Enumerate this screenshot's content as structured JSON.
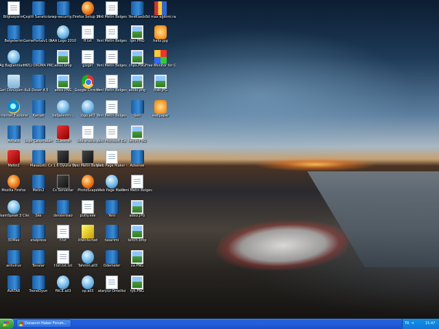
{
  "desktop": {
    "icons": [
      {
        "label": "Bilgisayarım",
        "type": "ic-doc",
        "icon": "computer-icon"
      },
      {
        "label": "Belgelerim",
        "type": "ic-folder",
        "icon": "my-documents-icon"
      },
      {
        "label": "Ağ Bağlantılarım",
        "type": "ic-orb",
        "icon": "network-icon"
      },
      {
        "label": "Geri Dönüşüm Kutusu",
        "type": "ic-trash",
        "icon": "recycle-bin-icon"
      },
      {
        "label": "Internet Explorer",
        "type": "ic-ie",
        "icon": "internet-explorer-icon"
      },
      {
        "label": "AvRack",
        "type": "ic-folder",
        "icon": "folder-icon"
      },
      {
        "label": "Metin2",
        "type": "ic-red",
        "icon": "game-icon"
      },
      {
        "label": "Mozilla Firefox",
        "type": "ic-app",
        "icon": "firefox-icon"
      },
      {
        "label": "TeamSpeak 3 Client",
        "type": "ic-orb",
        "icon": "teamspeak-icon"
      },
      {
        "label": "3DMax",
        "type": "ic-folder",
        "icon": "folder-icon"
      },
      {
        "label": "antivirus",
        "type": "ic-folder",
        "icon": "folder-icon"
      },
      {
        "label": "AVATAR",
        "type": "ic-folder",
        "icon": "folder-icon"
      },
      {
        "label": "Çeşitli Sanatcılar...",
        "type": "ic-folder",
        "icon": "folder-icon"
      },
      {
        "label": "GamePortalv1 Oyun Portalı...",
        "type": "ic-folder",
        "icon": "folder-icon"
      },
      {
        "label": "HIZLI OKUMA PRO",
        "type": "ic-folder",
        "icon": "folder-icon"
      },
      {
        "label": "3-Doser 4.5",
        "type": "ic-folder",
        "icon": "folder-icon"
      },
      {
        "label": "Karışık",
        "type": "ic-folder",
        "icon": "folder-icon"
      },
      {
        "label": "Logo Çalışmaları",
        "type": "ic-folder",
        "icon": "folder-icon"
      },
      {
        "label": "Masaüstü",
        "type": "ic-folder",
        "icon": "folder-icon"
      },
      {
        "label": "Metin2",
        "type": "ic-folder",
        "icon": "folder-icon"
      },
      {
        "label": "Ske",
        "type": "ic-folder",
        "icon": "folder-icon"
      },
      {
        "label": "etalpress",
        "type": "ic-folder",
        "icon": "folder-icon"
      },
      {
        "label": "Tenalar",
        "type": "ic-folder",
        "icon": "folder-icon"
      },
      {
        "label": "TrendOyun",
        "type": "ic-folder",
        "icon": "folder-icon"
      },
      {
        "label": "wp-security...",
        "type": "ic-folder",
        "icon": "folder-icon"
      },
      {
        "label": "AAA Logo 2010",
        "type": "ic-orb",
        "icon": "app-icon"
      },
      {
        "label": "adsız.bmp",
        "type": "ic-img",
        "icon": "image-icon"
      },
      {
        "label": "adsız.PNG",
        "type": "ic-img",
        "icon": "image-icon"
      },
      {
        "label": "belgelerim...",
        "type": "ic-orb",
        "icon": "app-icon"
      },
      {
        "label": "CCleaner",
        "type": "ic-red",
        "icon": "ccleaner-icon"
      },
      {
        "label": "Cs 1.6 Oyuna Oyun Yönetimi",
        "type": "ic-game",
        "icon": "game-icon"
      },
      {
        "label": "Cs Serverlar",
        "type": "ic-game",
        "icon": "game-icon"
      },
      {
        "label": "derslerisao",
        "type": "ic-folder",
        "icon": "folder-icon"
      },
      {
        "label": "f.txt",
        "type": "ic-doc",
        "icon": "text-file-icon"
      },
      {
        "label": "f.txt.txt.txt",
        "type": "ic-doc",
        "icon": "text-file-icon"
      },
      {
        "label": "FACE.all3",
        "type": "ic-orb",
        "icon": "app-icon"
      },
      {
        "label": "Firefox Setup 13.0.1.exe",
        "type": "ic-app",
        "icon": "firefox-setup-icon"
      },
      {
        "label": "ff.txt",
        "type": "ic-doc",
        "icon": "text-file-icon"
      },
      {
        "label": "gizgiri",
        "type": "ic-doc",
        "icon": "text-file-icon"
      },
      {
        "label": "Google Chrome",
        "type": "ic-chrome",
        "icon": "chrome-icon"
      },
      {
        "label": "logo.all3",
        "type": "ic-orb",
        "icon": "app-icon"
      },
      {
        "label": "lulu-arabia...",
        "type": "ic-doc",
        "icon": "text-file-icon"
      },
      {
        "label": "Yeni Metin Belgesi (7).txt",
        "type": "ic-game",
        "icon": "game-icon"
      },
      {
        "label": "PhotoScape",
        "type": "ic-app",
        "icon": "photoscape-icon"
      },
      {
        "label": "putty.exe",
        "type": "ic-doc",
        "icon": "app-icon"
      },
      {
        "label": "XfeInfected",
        "type": "ic-yellow",
        "icon": "app-icon"
      },
      {
        "label": "Tahmin.all3",
        "type": "ic-orb",
        "icon": "app-icon"
      },
      {
        "label": "xp.all3",
        "type": "ic-orb",
        "icon": "app-icon"
      },
      {
        "label": "Yeni Metin Belgesi (2).txt",
        "type": "ic-doc",
        "icon": "text-file-icon"
      },
      {
        "label": "Yeni Metin Belgesi (3).txt",
        "type": "ic-doc",
        "icon": "text-file-icon"
      },
      {
        "label": "Yeni Metin Belgesi (4).txt",
        "type": "ic-doc",
        "icon": "text-file-icon"
      },
      {
        "label": "Yeni Metin Belgesi (5).txt",
        "type": "ic-doc",
        "icon": "text-file-icon"
      },
      {
        "label": "Yeni Metin Belgesi.txt",
        "type": "ic-doc",
        "icon": "text-file-icon"
      },
      {
        "label": "Yeni Microsoft Excel Çalış...",
        "type": "ic-doc",
        "icon": "excel-icon"
      },
      {
        "label": "Web Page Maker v3...",
        "type": "ic-doc",
        "icon": "app-icon"
      },
      {
        "label": "Web Page Maker",
        "type": "ic-orb",
        "icon": "app-icon"
      },
      {
        "label": "Yeni",
        "type": "ic-folder",
        "icon": "folder-icon"
      },
      {
        "label": "tasarimi",
        "type": "ic-folder",
        "icon": "folder-icon"
      },
      {
        "label": "Ödemeler",
        "type": "ic-folder",
        "icon": "folder-icon"
      },
      {
        "label": "ataryüz Ömellisi",
        "type": "ic-doc",
        "icon": "text-file-icon"
      },
      {
        "label": "YeniKlasör",
        "type": "ic-folder",
        "icon": "folder-icon"
      },
      {
        "label": "lgın.PNG",
        "type": "ic-img",
        "icon": "image-icon"
      },
      {
        "label": "chps.PNG",
        "type": "ic-img",
        "icon": "image-icon"
      },
      {
        "label": "astlbi.png",
        "type": "ic-img",
        "icon": "image-icon"
      },
      {
        "label": "Seti",
        "type": "ic-folder",
        "icon": "folder-icon"
      },
      {
        "label": "tercih.PNG",
        "type": "ic-img",
        "icon": "image-icon"
      },
      {
        "label": "Adsense",
        "type": "ic-folder",
        "icon": "folder-icon"
      },
      {
        "label": "Yeni Metin Belgesi (6).txt",
        "type": "ic-doc",
        "icon": "text-file-icon"
      },
      {
        "label": "adsız.JPG",
        "type": "ic-img",
        "icon": "image-icon"
      },
      {
        "label": "tercih.bmp",
        "type": "ic-img",
        "icon": "image-icon"
      },
      {
        "label": "xa.PNG",
        "type": "ic-img",
        "icon": "image-icon"
      },
      {
        "label": "tyk.PNG",
        "type": "ic-img",
        "icon": "image-icon"
      },
      {
        "label": "3d max eğitimi.rar",
        "type": "ic-zip",
        "icon": "archive-icon"
      },
      {
        "label": "haltz.jpg",
        "type": "ic-orange",
        "icon": "image-icon"
      },
      {
        "label": "Free Monitor for Google",
        "type": "ic-grid",
        "icon": "app-icon"
      },
      {
        "label": "trab.JPG",
        "type": "ic-img",
        "icon": "image-icon"
      },
      {
        "label": "wallpaper",
        "type": "ic-orange",
        "icon": "image-icon"
      }
    ]
  },
  "taskbar": {
    "start_label": "",
    "task_label": "Donanım Haber Forum...",
    "lang": "TR",
    "clock": "15:47"
  }
}
